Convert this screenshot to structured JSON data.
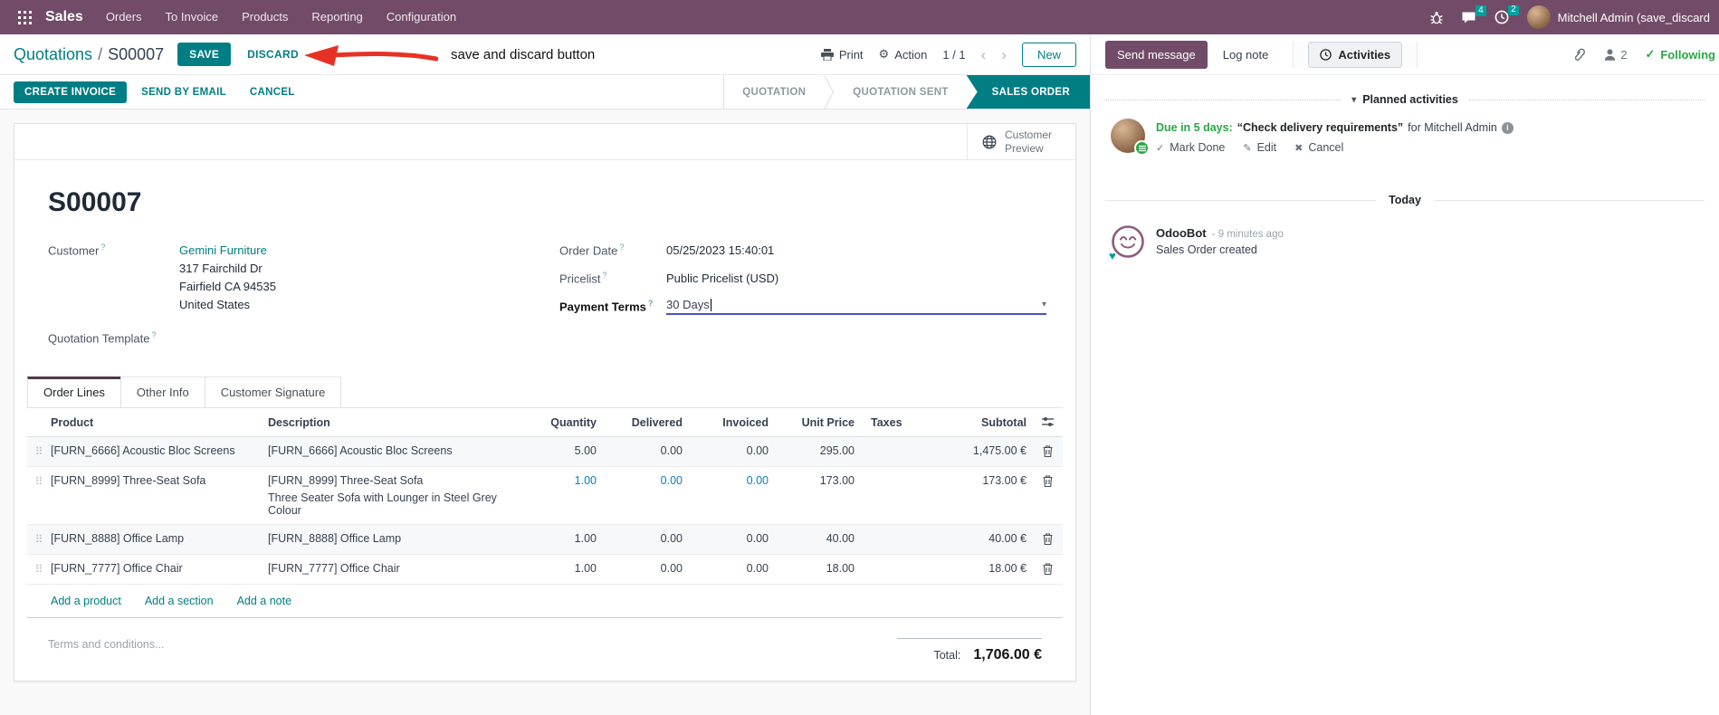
{
  "icons": {
    "gear": "⚙",
    "chevron_left": "‹",
    "chevron_right": "›",
    "caret_down": "▾",
    "collapse_caret": "▾",
    "check": "✓",
    "pencil": "✎",
    "cross": "✖",
    "heart": "♥",
    "drag": "⠿",
    "info": "i",
    "question": "?"
  },
  "nav": {
    "app_name": "Sales",
    "items": [
      "Orders",
      "To Invoice",
      "Products",
      "Reporting",
      "Configuration"
    ],
    "messages_badge": "4",
    "activities_badge": "2",
    "user_name": "Mitchell Admin (save_discard"
  },
  "control_panel": {
    "breadcrumb_parent": "Quotations",
    "breadcrumb_sep": "/",
    "breadcrumb_current": "S00007",
    "save_label": "SAVE",
    "discard_label": "DISCARD",
    "annotation_text": "save and discard button",
    "print_label": "Print",
    "action_label": "Action",
    "pager": "1 / 1",
    "new_label": "New"
  },
  "statusbar": {
    "create_invoice": "CREATE INVOICE",
    "send_by_email": "SEND BY EMAIL",
    "cancel": "CANCEL",
    "steps": [
      "QUOTATION",
      "QUOTATION SENT",
      "SALES ORDER"
    ],
    "active_step": "SALES ORDER"
  },
  "sheet": {
    "customer_preview": "Customer Preview",
    "title": "S00007",
    "fields": {
      "customer_label": "Customer",
      "customer_value": "Gemini Furniture",
      "address_line1": "317 Fairchild Dr",
      "address_line2": "Fairfield CA 94535",
      "address_line3": "United States",
      "quotation_template_label": "Quotation Template",
      "order_date_label": "Order Date",
      "order_date_value": "05/25/2023 15:40:01",
      "pricelist_label": "Pricelist",
      "pricelist_value": "Public Pricelist (USD)",
      "payment_terms_label": "Payment Terms",
      "payment_terms_value": "30 Days"
    },
    "tabs": [
      "Order Lines",
      "Other Info",
      "Customer Signature"
    ],
    "active_tab": "Order Lines",
    "table": {
      "headers": {
        "product": "Product",
        "description": "Description",
        "quantity": "Quantity",
        "delivered": "Delivered",
        "invoiced": "Invoiced",
        "unit_price": "Unit Price",
        "taxes": "Taxes",
        "subtotal": "Subtotal"
      },
      "rows": [
        {
          "product": "[FURN_6666] Acoustic Bloc Screens",
          "description": "[FURN_6666] Acoustic Bloc Screens",
          "description2": "",
          "quantity": "5.00",
          "delivered": "0.00",
          "invoiced": "0.00",
          "unit_price": "295.00",
          "taxes": "",
          "subtotal": "1,475.00 €"
        },
        {
          "product": "[FURN_8999] Three-Seat Sofa",
          "description": "[FURN_8999] Three-Seat Sofa",
          "description2": "Three Seater Sofa with Lounger in Steel Grey Colour",
          "quantity": "1.00",
          "delivered": "0.00",
          "invoiced": "0.00",
          "unit_price": "173.00",
          "taxes": "",
          "subtotal": "173.00 €"
        },
        {
          "product": "[FURN_8888] Office Lamp",
          "description": "[FURN_8888] Office Lamp",
          "description2": "",
          "quantity": "1.00",
          "delivered": "0.00",
          "invoiced": "0.00",
          "unit_price": "40.00",
          "taxes": "",
          "subtotal": "40.00 €"
        },
        {
          "product": "[FURN_7777] Office Chair",
          "description": "[FURN_7777] Office Chair",
          "description2": "",
          "quantity": "1.00",
          "delivered": "0.00",
          "invoiced": "0.00",
          "unit_price": "18.00",
          "taxes": "",
          "subtotal": "18.00 €"
        }
      ],
      "add_product": "Add a product",
      "add_section": "Add a section",
      "add_note": "Add a note"
    },
    "terms_placeholder": "Terms and conditions...",
    "total_label": "Total:",
    "total_value": "1,706.00 €"
  },
  "chatter": {
    "send_message": "Send message",
    "log_note": "Log note",
    "activities": "Activities",
    "followers_count": "2",
    "following": "Following",
    "planned_header": "Planned activities",
    "activity": {
      "due": "Due in 5 days:",
      "summary": "“Check delivery requirements”",
      "assignee": "for Mitchell Admin",
      "mark_done": "Mark Done",
      "edit": "Edit",
      "cancel": "Cancel"
    },
    "today_divider": "Today",
    "message": {
      "author": "OdooBot",
      "time": "- 9 minutes ago",
      "body": "Sales Order created"
    }
  },
  "colors": {
    "brand_purple": "#714B67",
    "accent_teal": "#017E84",
    "badge_teal": "#00A09D",
    "activity_green": "#28a745",
    "modified_blue": "#0880be",
    "annotation_red": "#e63226"
  }
}
